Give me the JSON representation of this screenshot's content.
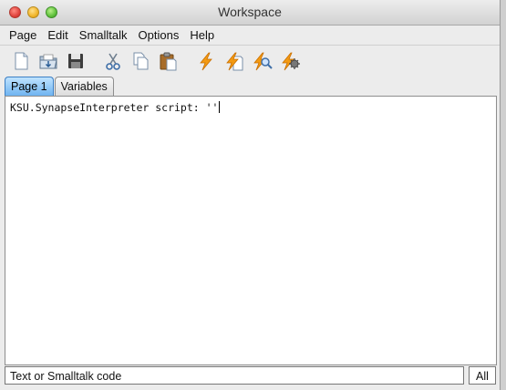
{
  "window": {
    "title": "Workspace"
  },
  "menu": [
    "Page",
    "Edit",
    "Smalltalk",
    "Options",
    "Help"
  ],
  "toolbar": {
    "icons": [
      "new-page-icon",
      "open-icon",
      "save-icon",
      "cut-icon",
      "copy-icon",
      "paste-icon",
      "do-it-icon",
      "print-it-icon",
      "inspect-it-icon",
      "debug-it-icon"
    ]
  },
  "tabs": [
    "Page 1",
    "Variables"
  ],
  "editor": {
    "code": "KSU.SynapseInterpreter script: ''"
  },
  "status": {
    "left": "Text or Smalltalk code",
    "right": "All"
  },
  "colors": {
    "active_tab": "#6fb3f0",
    "lightning": "#f39a12"
  }
}
